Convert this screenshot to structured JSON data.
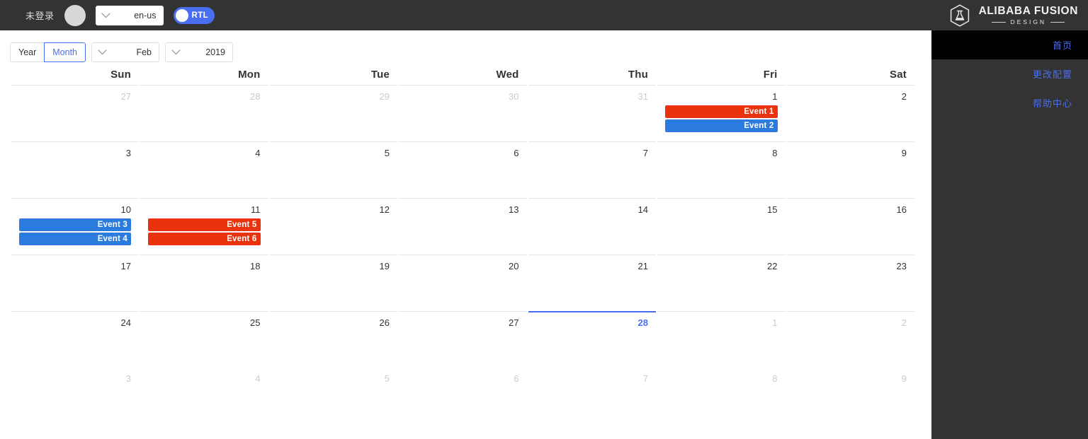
{
  "topbar": {
    "login_status": "未登录",
    "avatar_name": "avatar",
    "language": {
      "value": "en-us",
      "icon": "chevron-down-icon"
    },
    "rtl_toggle": {
      "label": "RTL",
      "on": true
    },
    "logo": {
      "mark_icon": "fusion-flask-shield-icon",
      "title": "ALIBABA FUSION",
      "subtitle": "DESIGN"
    }
  },
  "sidebar": {
    "items": [
      {
        "label": "首页",
        "active": true
      },
      {
        "label": "更改配置",
        "active": false
      },
      {
        "label": "帮助中心",
        "active": false
      }
    ]
  },
  "calendar": {
    "toolbar": {
      "modes": [
        {
          "label": "Year",
          "selected": false
        },
        {
          "label": "Month",
          "selected": true
        }
      ],
      "month_select": {
        "value": "Feb",
        "icon": "chevron-down-icon"
      },
      "year_select": {
        "value": "2019",
        "icon": "chevron-down-icon"
      }
    },
    "weekday_headers": [
      "Sat",
      "Fri",
      "Thu",
      "Wed",
      "Tue",
      "Mon",
      "Sun"
    ],
    "colors": {
      "event_red": "#e8330e",
      "event_blue": "#2b7cde",
      "accent": "#4a6ef0",
      "dim_text": "#c9cbd1"
    },
    "rows": [
      {
        "rule": true,
        "cells": [
          {
            "date": "2",
            "dim": false,
            "today": false,
            "events": []
          },
          {
            "date": "1",
            "dim": false,
            "today": false,
            "events": [
              {
                "label": "Event 1",
                "color": "#e8330e"
              },
              {
                "label": "Event 2",
                "color": "#2b7cde"
              }
            ]
          },
          {
            "date": "31",
            "dim": true,
            "today": false,
            "events": []
          },
          {
            "date": "30",
            "dim": true,
            "today": false,
            "events": []
          },
          {
            "date": "29",
            "dim": true,
            "today": false,
            "events": []
          },
          {
            "date": "28",
            "dim": true,
            "today": false,
            "events": []
          },
          {
            "date": "27",
            "dim": true,
            "today": false,
            "events": []
          }
        ]
      },
      {
        "rule": true,
        "cells": [
          {
            "date": "9",
            "dim": false,
            "today": false,
            "events": []
          },
          {
            "date": "8",
            "dim": false,
            "today": false,
            "events": []
          },
          {
            "date": "7",
            "dim": false,
            "today": false,
            "events": []
          },
          {
            "date": "6",
            "dim": false,
            "today": false,
            "events": []
          },
          {
            "date": "5",
            "dim": false,
            "today": false,
            "events": []
          },
          {
            "date": "4",
            "dim": false,
            "today": false,
            "events": []
          },
          {
            "date": "3",
            "dim": false,
            "today": false,
            "events": []
          }
        ]
      },
      {
        "rule": true,
        "cells": [
          {
            "date": "16",
            "dim": false,
            "today": false,
            "events": []
          },
          {
            "date": "15",
            "dim": false,
            "today": false,
            "events": []
          },
          {
            "date": "14",
            "dim": false,
            "today": false,
            "events": []
          },
          {
            "date": "13",
            "dim": false,
            "today": false,
            "events": []
          },
          {
            "date": "12",
            "dim": false,
            "today": false,
            "events": []
          },
          {
            "date": "11",
            "dim": false,
            "today": false,
            "events": [
              {
                "label": "Event 5",
                "color": "#e8330e"
              },
              {
                "label": "Event 6",
                "color": "#e8330e"
              }
            ]
          },
          {
            "date": "10",
            "dim": false,
            "today": false,
            "events": [
              {
                "label": "Event 3",
                "color": "#2b7cde"
              },
              {
                "label": "Event 4",
                "color": "#2b7cde"
              }
            ]
          }
        ]
      },
      {
        "rule": true,
        "cells": [
          {
            "date": "23",
            "dim": false,
            "today": false,
            "events": []
          },
          {
            "date": "22",
            "dim": false,
            "today": false,
            "events": []
          },
          {
            "date": "21",
            "dim": false,
            "today": false,
            "events": []
          },
          {
            "date": "20",
            "dim": false,
            "today": false,
            "events": []
          },
          {
            "date": "19",
            "dim": false,
            "today": false,
            "events": []
          },
          {
            "date": "18",
            "dim": false,
            "today": false,
            "events": []
          },
          {
            "date": "17",
            "dim": false,
            "today": false,
            "events": []
          }
        ]
      },
      {
        "rule": true,
        "cells": [
          {
            "date": "2",
            "dim": true,
            "today": false,
            "events": []
          },
          {
            "date": "1",
            "dim": true,
            "today": false,
            "events": []
          },
          {
            "date": "28",
            "dim": false,
            "today": true,
            "events": []
          },
          {
            "date": "27",
            "dim": false,
            "today": false,
            "events": []
          },
          {
            "date": "26",
            "dim": false,
            "today": false,
            "events": []
          },
          {
            "date": "25",
            "dim": false,
            "today": false,
            "events": []
          },
          {
            "date": "24",
            "dim": false,
            "today": false,
            "events": []
          }
        ]
      },
      {
        "rule": false,
        "cells": [
          {
            "date": "9",
            "dim": true,
            "today": false,
            "events": []
          },
          {
            "date": "8",
            "dim": true,
            "today": false,
            "events": []
          },
          {
            "date": "7",
            "dim": true,
            "today": false,
            "events": []
          },
          {
            "date": "6",
            "dim": true,
            "today": false,
            "events": []
          },
          {
            "date": "5",
            "dim": true,
            "today": false,
            "events": []
          },
          {
            "date": "4",
            "dim": true,
            "today": false,
            "events": []
          },
          {
            "date": "3",
            "dim": true,
            "today": false,
            "events": []
          }
        ]
      }
    ]
  }
}
